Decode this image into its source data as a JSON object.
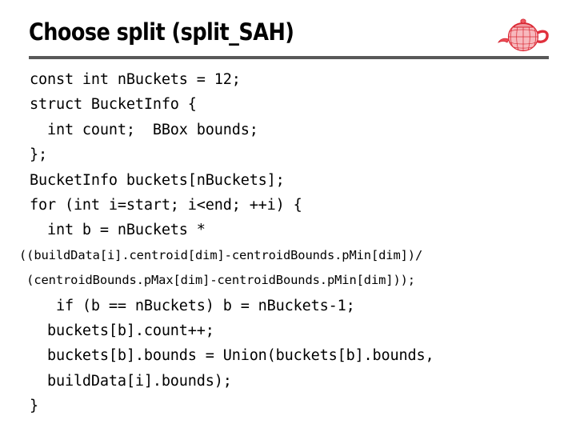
{
  "slide": {
    "title": "Choose split (split_SAH)",
    "logo_icon": "teapot-wireframe-icon",
    "colors": {
      "background": "#ffffff",
      "title_text": "#000000",
      "rule": "#595959",
      "code_text": "#000000",
      "teapot_red": "#e8303a",
      "teapot_light": "#f4a0a5"
    },
    "code": [
      {
        "text": "const int nBuckets = 12;",
        "size": "normal"
      },
      {
        "text": "struct BucketInfo {",
        "size": "normal"
      },
      {
        "text": "  int count;  BBox bounds;",
        "size": "normal"
      },
      {
        "text": "};",
        "size": "normal"
      },
      {
        "text": "BucketInfo buckets[nBuckets];",
        "size": "normal"
      },
      {
        "text": "for (int i=start; i<end; ++i) {",
        "size": "normal"
      },
      {
        "text": "  int b = nBuckets *",
        "size": "normal"
      },
      {
        "text": "((buildData[i].centroid[dim]-centroidBounds.pMin[dim])/",
        "size": "small"
      },
      {
        "text": " (centroidBounds.pMax[dim]-centroidBounds.pMin[dim]));",
        "size": "small"
      },
      {
        "text": "   if (b == nBuckets) b = nBuckets-1;",
        "size": "normal"
      },
      {
        "text": "  buckets[b].count++;",
        "size": "normal"
      },
      {
        "text": "  buckets[b].bounds = Union(buckets[b].bounds,",
        "size": "normal"
      },
      {
        "text": "  buildData[i].bounds);",
        "size": "normal"
      },
      {
        "text": "}",
        "size": "normal"
      }
    ]
  }
}
